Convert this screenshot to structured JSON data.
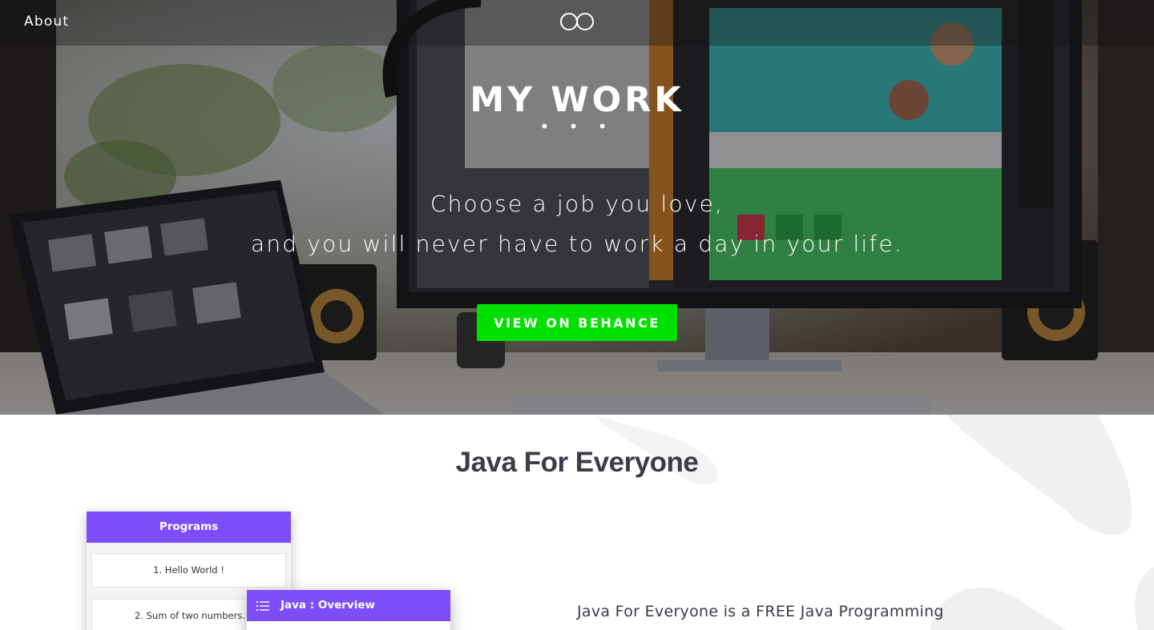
{
  "nav": {
    "about_label": "About",
    "logo_icon": "infinity-logo-icon"
  },
  "hero": {
    "title": "MY WORK",
    "dots": "• • •",
    "quote_line1": "Choose a job you love,",
    "quote_line2": "and you will never have to work a day in your life.",
    "cta_label": "VIEW ON BEHANCE",
    "cta_color": "#00e000"
  },
  "project": {
    "title": "Java For Everyone",
    "description": "Java For Everyone is a FREE Java Programming",
    "accent_color": "#7d4dfa",
    "mockup": {
      "programs_header": "Programs",
      "items": [
        "1. Hello World !",
        "2. Sum of two numbers."
      ],
      "overview_header": "Java : Overview",
      "overview_icon": "menu-list-icon"
    }
  }
}
